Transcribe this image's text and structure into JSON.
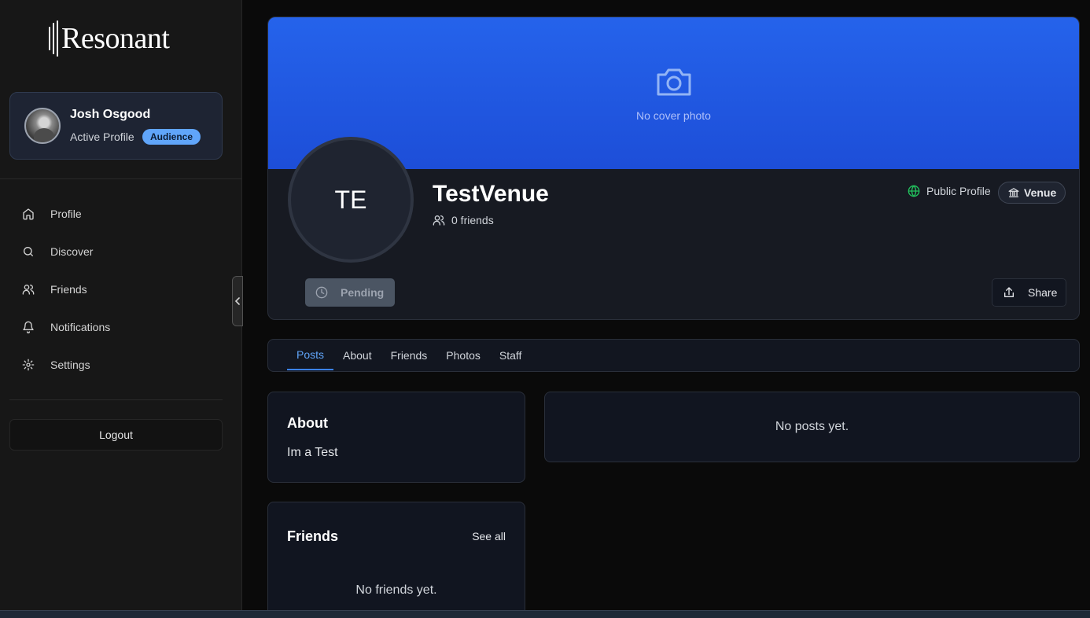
{
  "brand": {
    "name": "Resonant"
  },
  "user": {
    "name": "Josh Osgood",
    "active_label": "Active Profile",
    "role_badge": "Audience"
  },
  "nav": [
    {
      "label": "Profile",
      "icon": "home-icon"
    },
    {
      "label": "Discover",
      "icon": "search-icon"
    },
    {
      "label": "Friends",
      "icon": "users-icon"
    },
    {
      "label": "Notifications",
      "icon": "bell-icon"
    },
    {
      "label": "Settings",
      "icon": "gear-icon"
    }
  ],
  "logout_label": "Logout",
  "profile": {
    "cover_placeholder": "No cover photo",
    "initials": "TE",
    "name": "TestVenue",
    "friends_count": "0 friends",
    "visibility": "Public Profile",
    "type_badge": "Venue",
    "pending_label": "Pending",
    "share_label": "Share"
  },
  "tabs": [
    {
      "label": "Posts",
      "active": true
    },
    {
      "label": "About",
      "active": false
    },
    {
      "label": "Friends",
      "active": false
    },
    {
      "label": "Photos",
      "active": false
    },
    {
      "label": "Staff",
      "active": false
    }
  ],
  "about_card": {
    "title": "About",
    "text": "Im a Test"
  },
  "friends_card": {
    "title": "Friends",
    "see_all": "See all",
    "empty": "No friends yet."
  },
  "posts": {
    "empty": "No posts yet."
  },
  "colors": {
    "accent": "#3b82f6",
    "cover": "#2563eb",
    "public_icon": "#22c55e",
    "badge": "#60a5fa"
  }
}
